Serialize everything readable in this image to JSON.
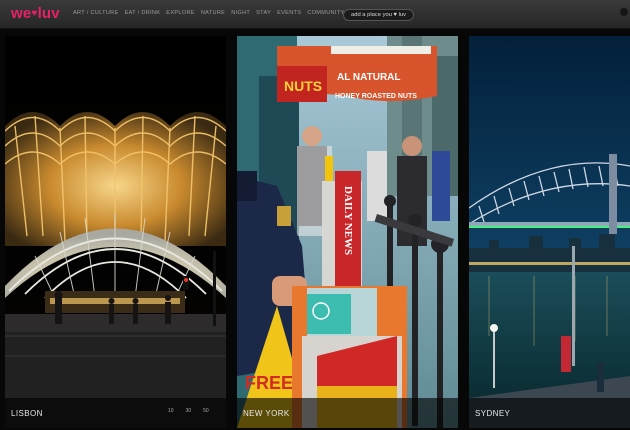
{
  "logo": {
    "left": "we",
    "heart": "♥",
    "right": "luv"
  },
  "nav": [
    "ART / CULTURE",
    "EAT / DRINK",
    "EXPLORE",
    "NATURE",
    "NIGHT",
    "STAY",
    "EVENTS",
    "COMMUNITY"
  ],
  "add_button": "add a place you ♥ luv",
  "photos": [
    {
      "city": "LISBON"
    },
    {
      "city": "NEW YORK",
      "signs": {
        "shop_top": "NUTS",
        "shop_sub": "AL NATURAL",
        "shop_line2": "HONEY ROASTED NUTS",
        "news": "DAILY NEWS",
        "free": "FREE"
      }
    },
    {
      "city": "SYDNEY"
    }
  ],
  "pager": [
    "10",
    "30",
    "50"
  ],
  "colors": {
    "brand": "#e8206a",
    "topbar": "#2e2e2e",
    "background": "#070707"
  }
}
